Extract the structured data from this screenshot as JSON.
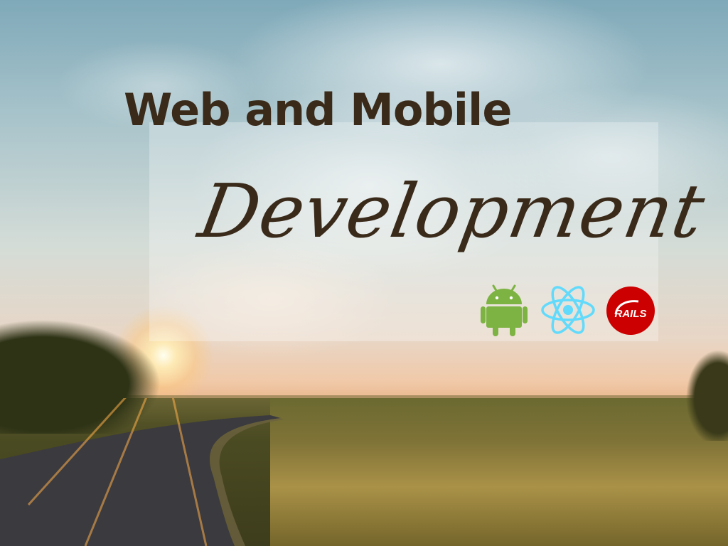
{
  "heading": {
    "title": "Web and Mobile",
    "subtitle": "Development"
  },
  "logos": [
    {
      "icon": "android-icon",
      "color": "#7cb342"
    },
    {
      "icon": "react-icon",
      "color": "#61dafb"
    },
    {
      "icon": "rails-icon",
      "color": "#cc0000",
      "text": "RAILS"
    }
  ]
}
